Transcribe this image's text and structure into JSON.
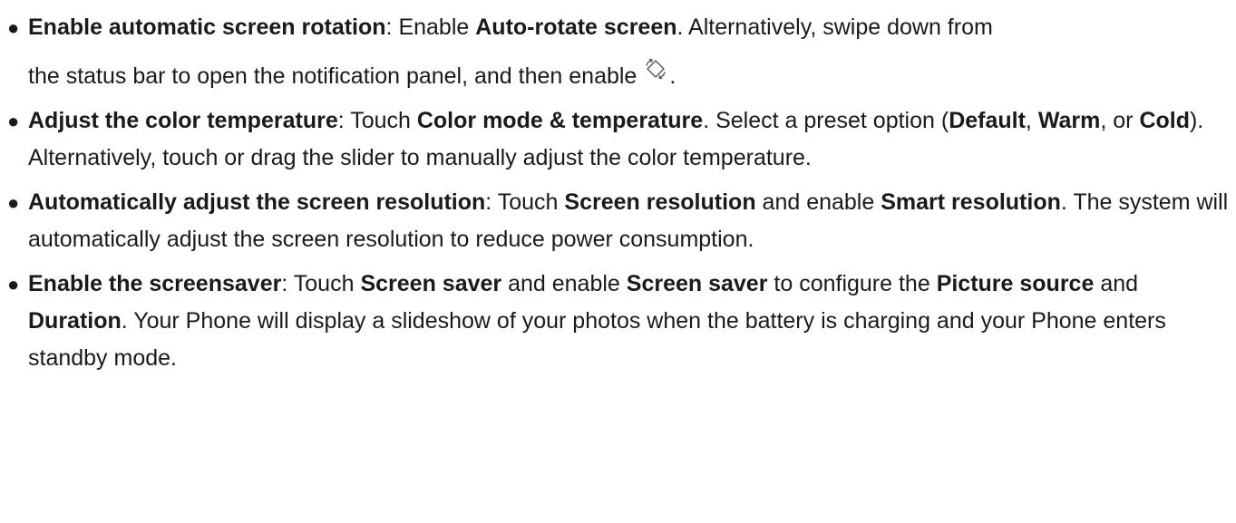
{
  "items": [
    {
      "title": "Enable automatic screen rotation",
      "sep": ": ",
      "t1": "Enable ",
      "b1": "Auto-rotate screen",
      "t2": ". Alternatively, swipe down from",
      "t3": "the status bar to open the notification panel, and then enable",
      "icon": "auto-rotate-icon",
      "t4": "."
    },
    {
      "title": "Adjust the color temperature",
      "sep": ": ",
      "t1": "Touch ",
      "b1": "Color mode & temperature",
      "t2": ". Select a preset option (",
      "b2": "Default",
      "t3": ", ",
      "b3": "Warm",
      "t4": ", or ",
      "b4": "Cold",
      "t5": "). Alternatively, touch or drag the slider to manually adjust the color temperature."
    },
    {
      "title": "Automatically adjust the screen resolution",
      "sep": ": ",
      "t1": "Touch ",
      "b1": "Screen resolution",
      "t2": " and enable ",
      "b2": "Smart resolution",
      "t3": ". The system will automatically adjust the screen resolution to reduce power consumption."
    },
    {
      "title": "Enable the screensaver",
      "sep": ": ",
      "t1": "Touch ",
      "b1": "Screen saver",
      "t2": " and enable ",
      "b2": "Screen saver",
      "t3": " to configure the ",
      "b3": "Picture source",
      "t4": " and ",
      "b4": "Duration",
      "t5": ". Your Phone will display a slideshow of your photos when the battery is charging and your Phone enters standby mode."
    }
  ]
}
